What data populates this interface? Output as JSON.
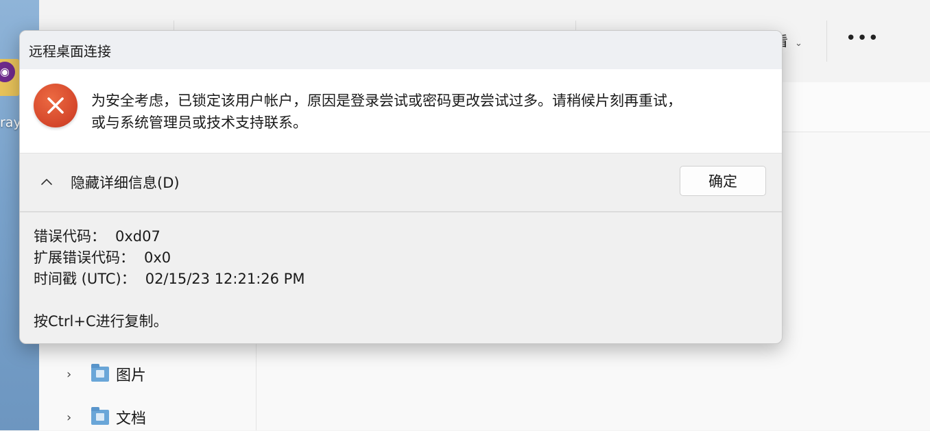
{
  "desktop": {
    "icon_label": "ray"
  },
  "explorer": {
    "toolbar": {
      "view_label": "看",
      "more_label": "•••"
    },
    "nav_items": [
      {
        "label": "图片"
      },
      {
        "label": "文档"
      }
    ]
  },
  "dialog": {
    "title": "远程桌面连接",
    "message_line1": "为安全考虑，已锁定该用户帐户，原因是登录尝试或密码更改尝试过多。请稍候片刻再重试，",
    "message_line2": "或与系统管理员或技术支持联系。",
    "details_toggle_label": "隐藏详细信息(D)",
    "ok_label": "确定",
    "details": {
      "error_code_label": "错误代码：",
      "error_code_value": "0xd07",
      "ext_error_code_label": "扩展错误代码：",
      "ext_error_code_value": "0x0",
      "timestamp_label": "时间戳 (UTC)：",
      "timestamp_value": "02/15/23 12:21:26 PM",
      "copy_hint": "按Ctrl+C进行复制。"
    }
  },
  "colors": {
    "error_icon": "#d4462a",
    "dialog_bg": "#f0f0f0",
    "body_bg": "#ffffff"
  }
}
